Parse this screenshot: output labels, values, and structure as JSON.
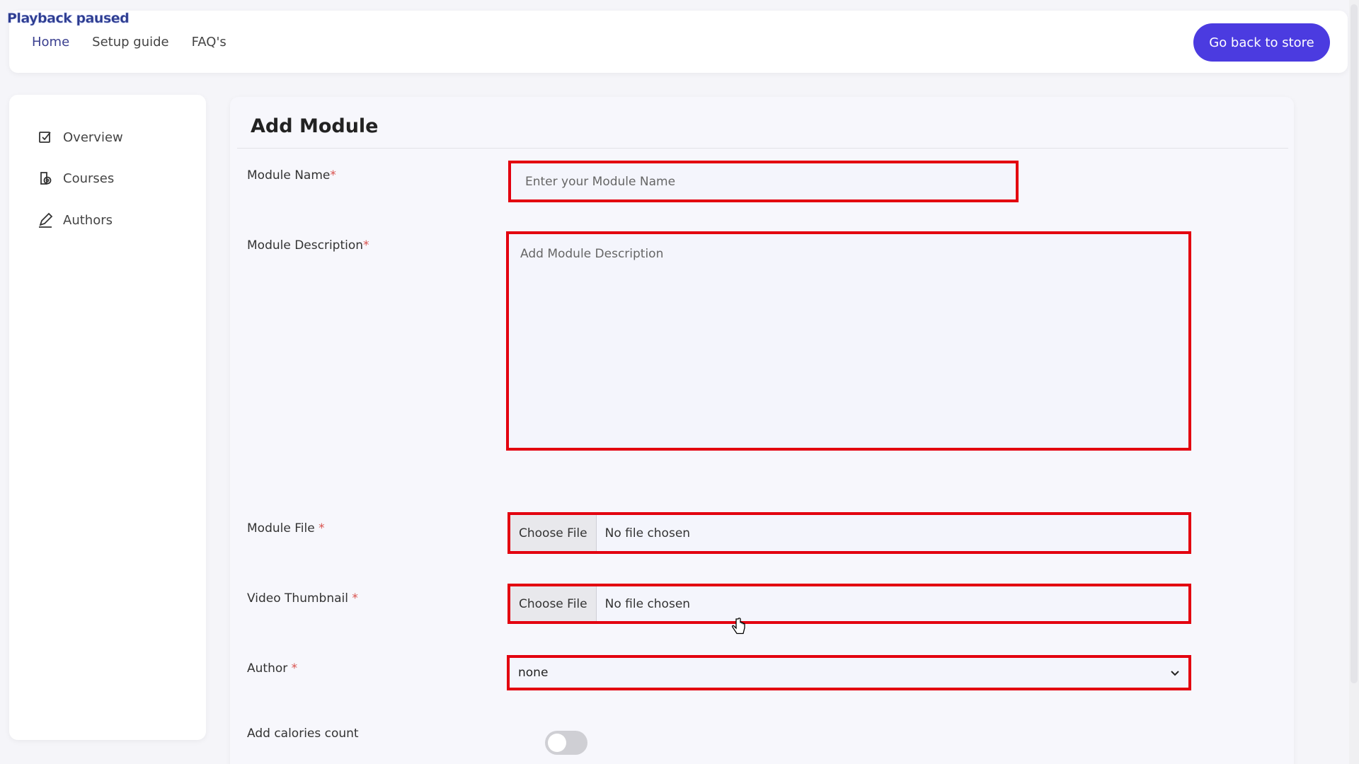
{
  "overlay": {
    "status": "Playback paused"
  },
  "topbar": {
    "nav": [
      "Home",
      "Setup guide",
      "FAQ's"
    ],
    "store_button": "Go back to store"
  },
  "sidebar": {
    "items": [
      {
        "label": "Overview",
        "icon": "overview-icon"
      },
      {
        "label": "Courses",
        "icon": "courses-icon"
      },
      {
        "label": "Authors",
        "icon": "pen-icon"
      }
    ]
  },
  "form": {
    "title": "Add Module",
    "module_name": {
      "label": "Module Name",
      "req": "*",
      "placeholder": "Enter your Module Name"
    },
    "module_description": {
      "label": "Module Description",
      "req": "*",
      "placeholder": "Add Module Description"
    },
    "module_file": {
      "label": "Module File ",
      "req": "*",
      "button": "Choose File",
      "status": "No file chosen"
    },
    "video_thumbnail": {
      "label": "Video Thumbnail ",
      "req": "*",
      "button": "Choose File",
      "status": "No file chosen"
    },
    "author": {
      "label": "Author ",
      "req": "*",
      "value": "none"
    },
    "calories": {
      "label": "Add calories count",
      "enabled": false
    }
  },
  "colors": {
    "accent": "#4b3be0",
    "highlight_border": "#e3000f",
    "required": "#d9534f"
  }
}
